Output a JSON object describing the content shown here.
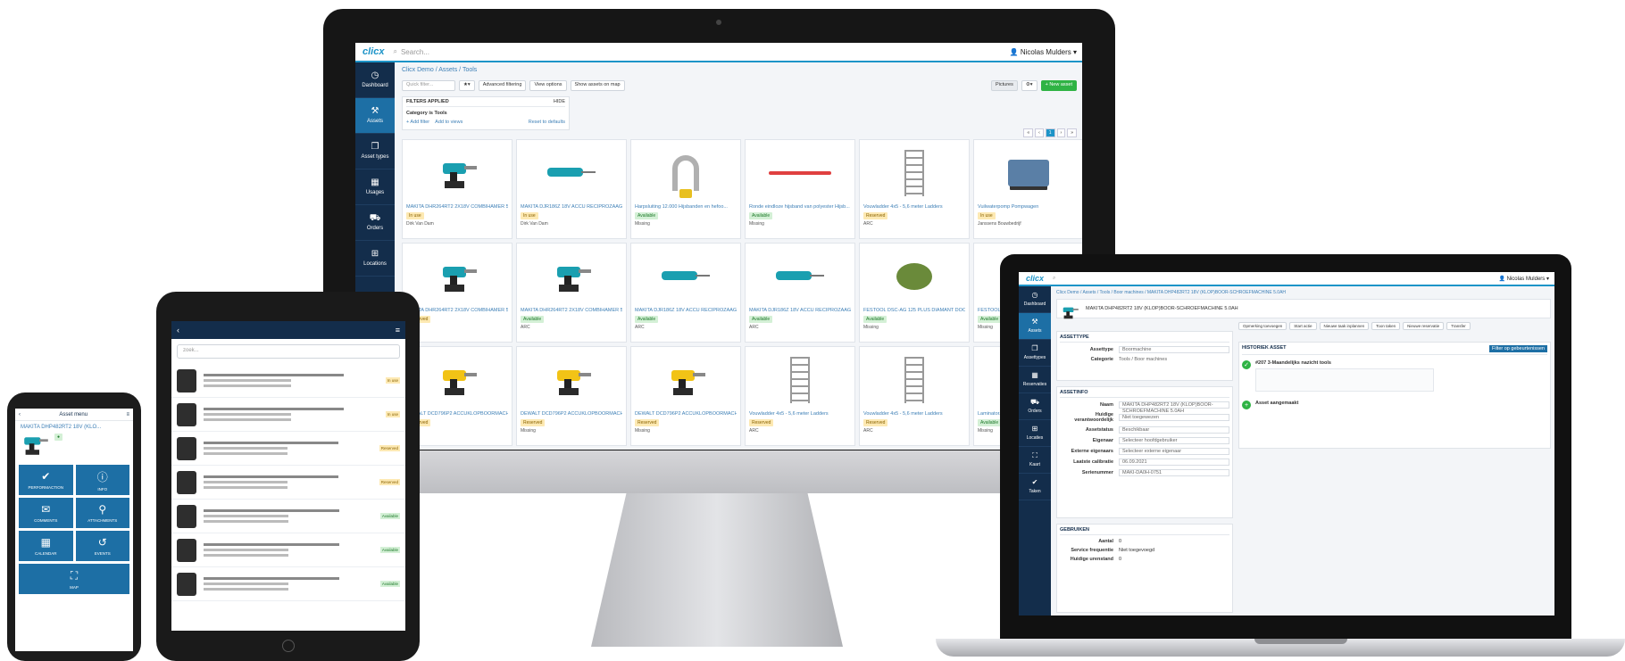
{
  "desktop": {
    "app_logo": "clicx",
    "search_placeholder": "Search...",
    "user_name": "Nicolas Mulders",
    "sidebar": [
      {
        "label": "Dashboard",
        "icon": "dashboard-icon",
        "glyph": "◷"
      },
      {
        "label": "Assets",
        "icon": "assets-icon",
        "glyph": "⚒"
      },
      {
        "label": "Asset types",
        "icon": "asset-types-icon",
        "glyph": "❐"
      },
      {
        "label": "Usages",
        "icon": "calendar-icon",
        "glyph": "▦"
      },
      {
        "label": "Orders",
        "icon": "cart-icon",
        "glyph": "⛟"
      },
      {
        "label": "Locations",
        "icon": "locations-icon",
        "glyph": "⊞"
      }
    ],
    "breadcrumb": "Clicx Demo / Assets / Tools",
    "toolbar": {
      "quick_filter": "Quick filter...",
      "advanced_filtering": "Advanced filtering",
      "view_options": "View options",
      "show_on_map": "Show assets on map",
      "view_toggle": "Pictures",
      "new_asset": "+ New asset"
    },
    "filters": {
      "heading": "FILTERS APPLIED",
      "hide": "HIDE",
      "category": "Category is Tools",
      "add_filter": "+ Add filter",
      "add_to_views": "Add to views",
      "reset": "Reset to defaults"
    },
    "pager_current": "1",
    "assets": [
      {
        "title": "MAKITA DHR264RT2 2X18V COMBIHAMER 5...",
        "status": "In use",
        "location": "Dirk Van Dam",
        "kind": "drill"
      },
      {
        "title": "MAKITA DJR186Z 18V ACCU RECIPROZAAG B...",
        "status": "In use",
        "location": "Dirk Van Dam",
        "kind": "saw"
      },
      {
        "title": "Harpsluiting 12.000 Hijsbanden en hefoo...",
        "status": "Available",
        "location": "Missing",
        "kind": "shackle"
      },
      {
        "title": "Ronde eindloze hijsband van polyester Hijsb...",
        "status": "Available",
        "location": "Missing",
        "kind": "strap"
      },
      {
        "title": "Vouwladder 4x5 - 5,6 meter Ladders",
        "status": "Reserved",
        "location": "ARC",
        "kind": "ladder"
      },
      {
        "title": "Vuilwaterpomp Pompwagen",
        "status": "In use",
        "location": "Janssens Bouwbedrijf",
        "kind": "trailer"
      },
      {
        "title": "MAKITA DHR264RT2 2X18V COMBIHAMER 5...",
        "status": "Reserved",
        "location": "ARC",
        "kind": "drill"
      },
      {
        "title": "MAKITA DHR264RT2 2X18V COMBIHAMER 5...",
        "status": "Available",
        "location": "ARC",
        "kind": "drill"
      },
      {
        "title": "MAKITA DJR186Z 18V ACCU RECIPROZAAG B...",
        "status": "Available",
        "location": "ARC",
        "kind": "saw"
      },
      {
        "title": "MAKITA DJR186Z 18V ACCU RECIPROZAAG B...",
        "status": "Available",
        "location": "ARC",
        "kind": "saw"
      },
      {
        "title": "FESTOOL DSC-AG 125 PLUS DIAMANT DOOR...",
        "status": "Available",
        "location": "Missing",
        "kind": "cutter"
      },
      {
        "title": "FESTOOL DSC...",
        "status": "Available",
        "location": "Missing",
        "kind": "cutter"
      },
      {
        "title": "DEWALT DCD796P2 ACCUKLOPBOORMACH...",
        "status": "Reserved",
        "location": "ARC",
        "kind": "yellow"
      },
      {
        "title": "DEWALT DCD796P2 ACCUKLOPBOORMACH...",
        "status": "Reserved",
        "location": "Missing",
        "kind": "yellow"
      },
      {
        "title": "DEWALT DCD796P2 ACCUKLOPBOORMACH...",
        "status": "Reserved",
        "location": "Missing",
        "kind": "yellow"
      },
      {
        "title": "Vouwladder 4x5 - 5,6 meter Ladders",
        "status": "Reserved",
        "location": "ARC",
        "kind": "ladder"
      },
      {
        "title": "Vouwladder 4x5 - 5,6 meter Ladders",
        "status": "Reserved",
        "location": "ARC",
        "kind": "ladder"
      },
      {
        "title": "Laminator...",
        "status": "Available",
        "location": "Missing",
        "kind": "ladder"
      }
    ]
  },
  "tablet": {
    "search_placeholder": "zoek...",
    "rows": [
      "In use",
      "In use",
      "Reserved",
      "Reserved",
      "Available",
      "Available",
      "Available"
    ]
  },
  "phone": {
    "title": "Asset menu",
    "asset_name": "MAKITA DHP482RT2 18V (KLO...",
    "tiles": [
      {
        "label": "PERFORMACTION",
        "glyph": "✔",
        "icon": "check-icon"
      },
      {
        "label": "INFO",
        "glyph": "ⓘ",
        "icon": "info-icon"
      },
      {
        "label": "COMMENTS",
        "glyph": "✉",
        "icon": "comments-icon"
      },
      {
        "label": "ATTACHMENTS",
        "glyph": "⚲",
        "icon": "attachment-icon"
      },
      {
        "label": "CALENDAR",
        "glyph": "▦",
        "icon": "calendar-icon"
      },
      {
        "label": "EVENTS",
        "glyph": "↺",
        "icon": "history-icon"
      },
      {
        "label": "MAP",
        "glyph": "⛶",
        "icon": "map-icon"
      }
    ]
  },
  "laptop": {
    "app_logo": "clicx",
    "user_name": "Nicolas Mulders",
    "sidebar": [
      "Dashboard",
      "Assets",
      "Assettypes",
      "Reservaties",
      "Orders",
      "Locaties",
      "Kaart",
      "Taken"
    ],
    "breadcrumb": "Clicx Demo / Assets / Tools / Boor machines / MAKITA DHP482RT2 18V (KLOP)BOOR-SCHROEFMACHINE 5.0AH",
    "asset_title": "MAKITA DHP482RT2 18V (KLOP)BOOR-SCHROEFMACHINE 5.0AH",
    "actions": [
      "Opmerking toevoegen",
      "Start actie",
      "Nieuwe taak inplannen",
      "Toon taken",
      "Nieuwe reservatie",
      "Transfer"
    ],
    "assettype_section": "ASSETTYPE",
    "assettype_label": "Assettype",
    "assettype_value": "Boormachine",
    "category_label": "Categorie",
    "category_value": "Tools / Boor machines",
    "asset_section": "ASSETINFO",
    "fields": [
      {
        "label": "Naam",
        "value": "MAKITA DHP482RT2 18V (KLOP)BOOR-SCHROEFMACHINE 5.0AH"
      },
      {
        "label": "Huidige verantwoordelijk",
        "value": "Niet toegewezen"
      },
      {
        "label": "Assetstatus",
        "value": "Beschikbaar"
      },
      {
        "label": "Eigenaar",
        "value": "Selecteer hoofdgebruiker"
      },
      {
        "label": "Externe eigenaars",
        "value": "Selecteer externe eigenaar"
      },
      {
        "label": "Laatste calibratie",
        "value": "06.09.2021"
      },
      {
        "label": "Serienummer",
        "value": "MAKI-DA0H-0751"
      }
    ],
    "history_section": "HISTORIEK ASSET",
    "history_button": "Filter op gebeurtenissen",
    "history_event": "#207 3-Maandelijks nazicht tools",
    "history_event2": "Asset aangemaakt",
    "usage_section": "GEBRUIKEN",
    "usage_fields": [
      {
        "label": "Aantal",
        "value": "0"
      },
      {
        "label": "Service frequentie",
        "value": "Niet toegevoegd"
      },
      {
        "label": "Huidige urenstand",
        "value": "0"
      }
    ]
  }
}
